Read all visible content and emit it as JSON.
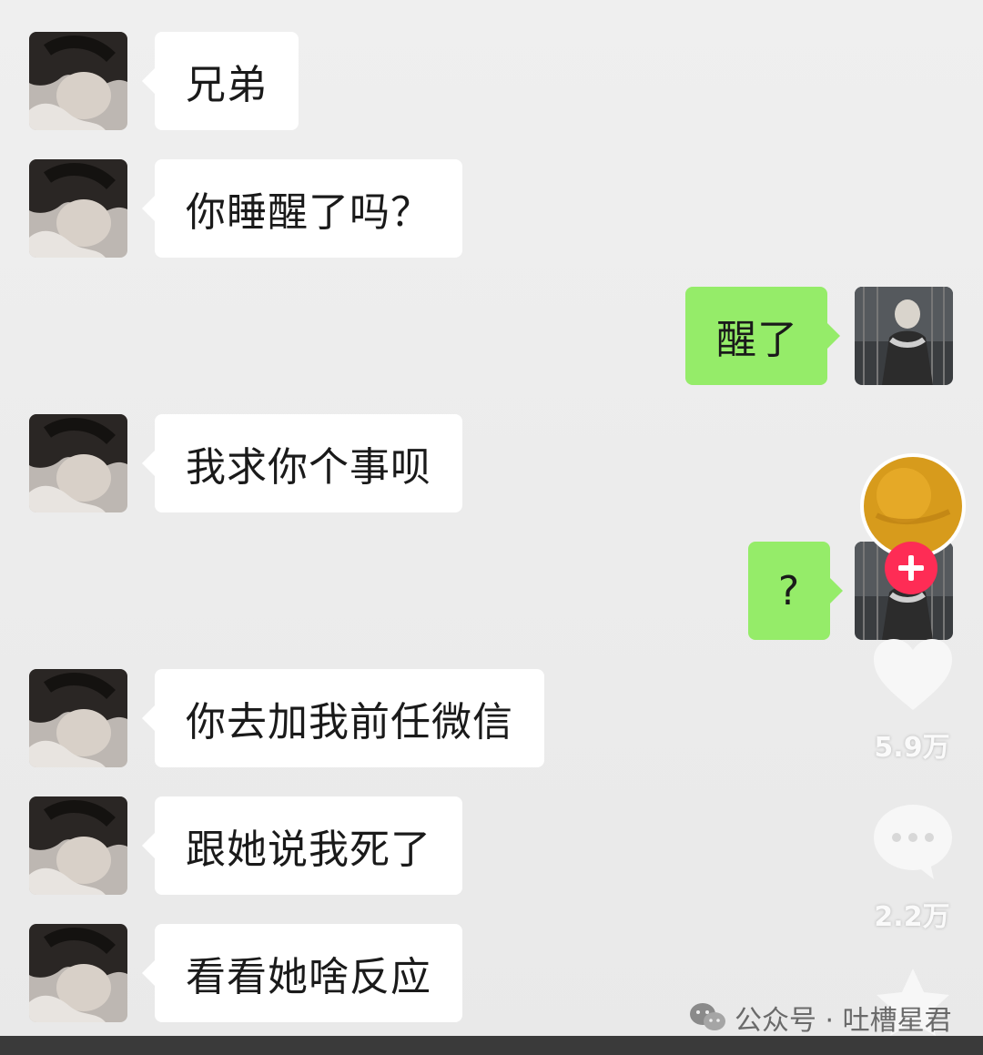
{
  "messages": [
    {
      "side": "left",
      "text": "兄弟"
    },
    {
      "side": "left",
      "text": "你睡醒了吗？"
    },
    {
      "side": "right",
      "text": "醒了"
    },
    {
      "side": "left",
      "text": "我求你个事呗"
    },
    {
      "side": "right",
      "text": "?"
    },
    {
      "side": "left",
      "text": "你去加我前任微信"
    },
    {
      "side": "left",
      "text": "跟她说我死了"
    },
    {
      "side": "left",
      "text": "看看她啥反应"
    }
  ],
  "overlay": {
    "likes": "5.9万",
    "comments": "2.2万",
    "follow_icon": "plus-icon"
  },
  "watermark": {
    "text": "公众号 · 吐槽星君",
    "icon": "wechat-icon"
  },
  "colors": {
    "sent_bubble": "#95ec69",
    "received_bubble": "#ffffff",
    "follow_badge": "#fe2c55"
  }
}
